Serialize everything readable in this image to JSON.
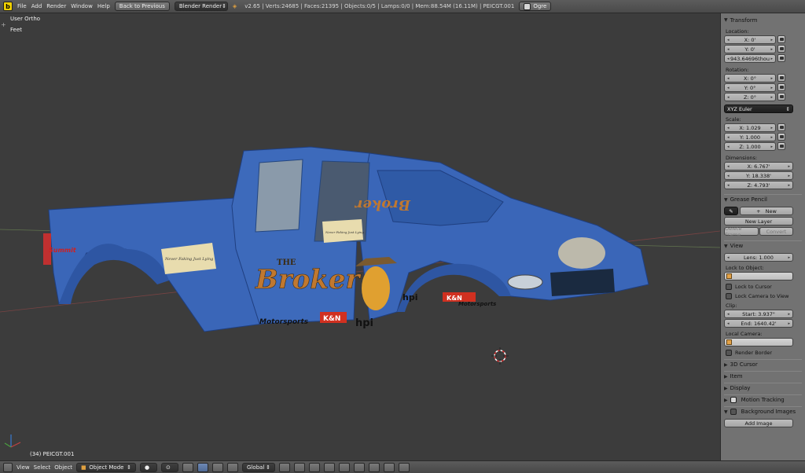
{
  "header": {
    "app_icon": "blender-logo-icon",
    "menus": [
      "File",
      "Add",
      "Render",
      "Window",
      "Help"
    ],
    "back_button": "Back to Previous",
    "engine": "Blender Render",
    "stats": "v2.65 | Verts:24685 | Faces:21395 | Objects:0/5 | Lamps:0/0 | Mem:88.54M (16.11M) | PEICGT.001",
    "ogre_label": "Ogre"
  },
  "viewport": {
    "view_name": "User Ortho",
    "units": "Feet",
    "object_label": "(34) PEICGT.001",
    "decals": {
      "the": "THE",
      "broker": "Broker",
      "broker_rear": "Broker",
      "motorsports": "Motorsports",
      "motorsports_rear": "Motorsports",
      "hpi": "hpi",
      "hpi_rear": "hpi",
      "kn": "K&N",
      "kn_rear": "K&N",
      "summit": "Summit",
      "scroll_text": "Never Faking Just Lying",
      "scroll_text_rear": "Never Faking Just Lying"
    }
  },
  "panel": {
    "transform": {
      "title": "Transform",
      "location_label": "Location:",
      "location": [
        "X: 0'",
        "Y: 0'",
        "943.64696thou"
      ],
      "rotation_label": "Rotation:",
      "rotation": [
        "X: 0°",
        "Y: 0°",
        "Z: 0°"
      ],
      "rotation_mode": "XYZ Euler",
      "scale_label": "Scale:",
      "scale": [
        "X: 1.029",
        "Y: 1.000",
        "Z: 1.000"
      ],
      "dimensions_label": "Dimensions:",
      "dimensions": [
        "X: 6.767'",
        "Y: 18.338'",
        "Z: 4.793'"
      ]
    },
    "grease_pencil": {
      "title": "Grease Pencil",
      "new": "New",
      "new_layer": "New Layer",
      "delete_frame": "Delete Frame",
      "convert": "Convert"
    },
    "view": {
      "title": "View",
      "lens": "Lens: 1.000",
      "lock_to_object": "Lock to Object:",
      "lock_to_cursor": "Lock to Cursor",
      "lock_camera_to_view": "Lock Camera to View",
      "clip_label": "Clip:",
      "clip_start": "Start: 3.937\"",
      "clip_end": "End: 1640.42'",
      "local_camera": "Local Camera:",
      "render_border": "Render Border"
    },
    "collapsed": {
      "cursor": "3D Cursor",
      "item": "Item",
      "display": "Display",
      "motion_tracking": "Motion Tracking",
      "background_images": "Background Images"
    },
    "add_image": "Add Image"
  },
  "footer": {
    "menus": [
      "View",
      "Select",
      "Object"
    ],
    "mode": "Object Mode",
    "orientation": "Global"
  },
  "colors": {
    "truck_body": "#3a66b8",
    "grid_x": "#b03a3a",
    "grid_y": "#5a9a30",
    "panel_bg": "#727272",
    "viewport_bg": "#3c3c3c"
  }
}
